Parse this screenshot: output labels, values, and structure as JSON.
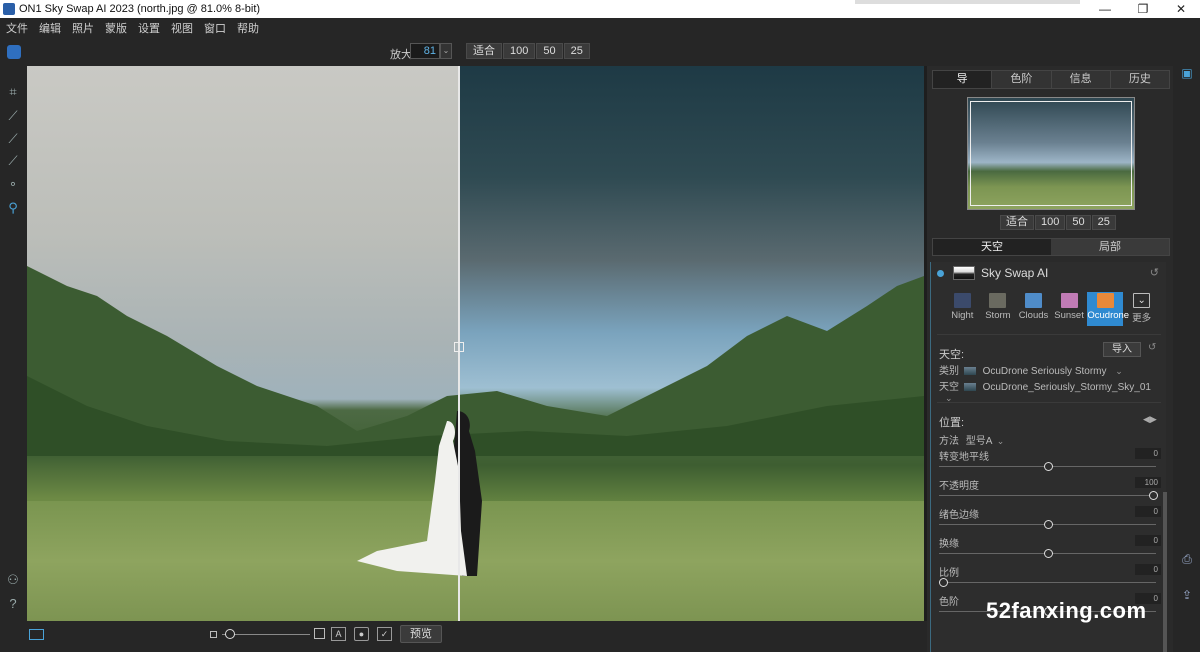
{
  "window": {
    "title": "ON1 Sky Swap AI 2023 (north.jpg @ 81.0% 8-bit)",
    "minimize": "—",
    "maximize": "❐",
    "close": "✕"
  },
  "menu": [
    "文件",
    "编辑",
    "照片",
    "蒙版",
    "设置",
    "视图",
    "窗口",
    "帮助"
  ],
  "toolbar": {
    "zoom_label": "放大",
    "zoom_value": "81",
    "zoom_presets": [
      "适合",
      "100",
      "50",
      "25"
    ]
  },
  "left_tools": [
    "crop-icon",
    "brush-icon",
    "mask-brush-icon",
    "line-mask-icon",
    "retouch-icon",
    "zoom-hand-icon"
  ],
  "bottom": {
    "text_icon": "A",
    "preview_label": "预览"
  },
  "panel": {
    "tabs": [
      "导",
      "色阶",
      "信息",
      "历史"
    ],
    "active_tab": "导",
    "nav_presets": [
      "适合",
      "100",
      "50",
      "25"
    ],
    "segments": [
      "天空",
      "局部"
    ],
    "active_segment": "天空",
    "module": {
      "title": "Sky Swap AI",
      "reset": "↺",
      "presets": [
        {
          "label": "Night",
          "color": "#3b4a6b"
        },
        {
          "label": "Storm",
          "color": "#6a6a60"
        },
        {
          "label": "Clouds",
          "color": "#4f8cc9"
        },
        {
          "label": "Sunset",
          "color": "#c07bb5"
        },
        {
          "label": "Ocudrone",
          "color": "#e8893a"
        },
        {
          "label": "更多",
          "color": ""
        }
      ],
      "selected_preset": "Ocudrone",
      "sky_title": "天空:",
      "import_label": "导入",
      "category_label": "类别",
      "category_value": "OcuDrone Seriously Stormy",
      "sky_label": "天空",
      "sky_value": "OcuDrone_Seriously_Stormy_Sky_01",
      "position_title": "位置:",
      "method_label": "方法",
      "method_value": "型号A",
      "sliders": [
        {
          "label": "转变地平线",
          "value": "0",
          "level": 0.5
        },
        {
          "label": "不透明度",
          "value": "100",
          "level": 1.0
        },
        {
          "label": "绪色边缘",
          "value": "0",
          "level": 0.5
        },
        {
          "label": "换缘",
          "value": "0",
          "level": 0.5
        },
        {
          "label": "比例",
          "value": "0",
          "level": 0.0
        },
        {
          "label": "色阶",
          "value": "0",
          "level": 0.5
        }
      ]
    }
  },
  "watermark": "52fanxing.com",
  "colors": {
    "accent": "#2f8ad1",
    "bg": "#1e1e1e"
  }
}
